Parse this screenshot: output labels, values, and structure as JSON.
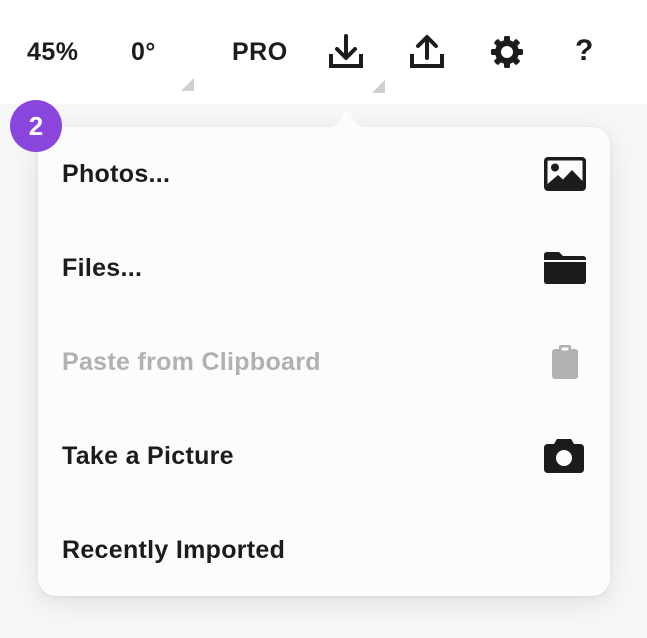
{
  "toolbar": {
    "zoom": "45%",
    "rotation": "0°",
    "pro_label": "PRO",
    "icons": {
      "download": "download-icon",
      "upload": "upload-icon",
      "settings": "gear-icon",
      "help": "?"
    }
  },
  "badge": {
    "number": "2",
    "color": "#8a45dd"
  },
  "import_menu": {
    "items": [
      {
        "label": "Photos...",
        "icon": "photo-icon",
        "enabled": true
      },
      {
        "label": "Files...",
        "icon": "folder-icon",
        "enabled": true
      },
      {
        "label": "Paste from Clipboard",
        "icon": "clipboard-icon",
        "enabled": false
      },
      {
        "label": "Take a Picture",
        "icon": "camera-icon",
        "enabled": true
      },
      {
        "label": "Recently Imported",
        "icon": "",
        "enabled": true
      }
    ]
  },
  "colors": {
    "text": "#1c1c1e",
    "disabled_text": "#b1b1b1",
    "menu_background": "#fcfcfc",
    "badge": "#8a45dd"
  }
}
